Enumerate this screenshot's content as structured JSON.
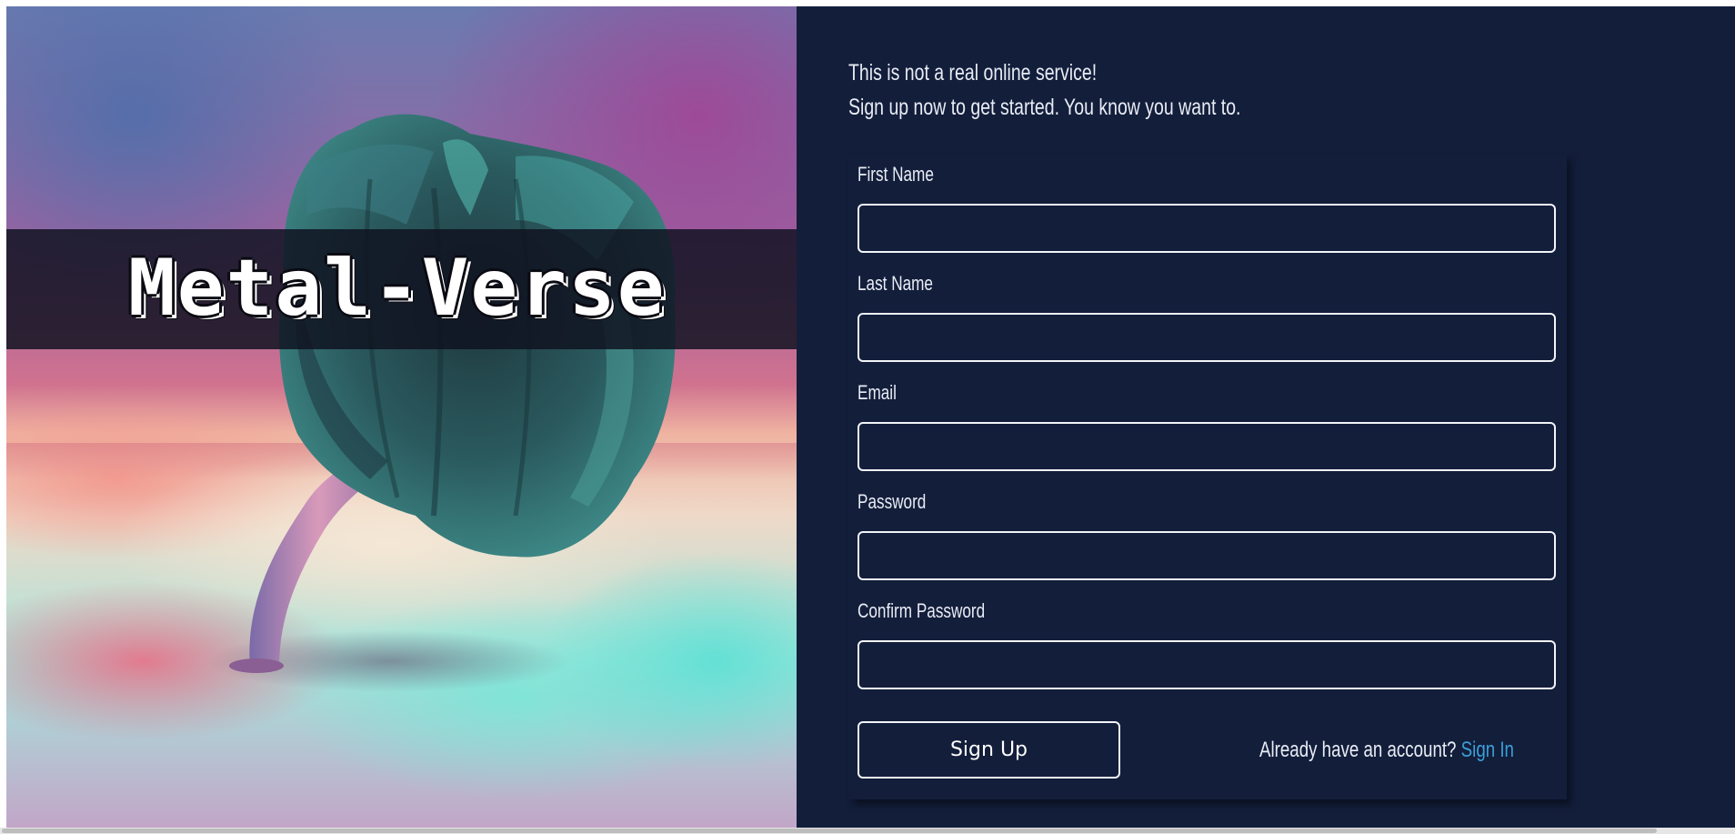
{
  "hero": {
    "brand": "Metal-Verse"
  },
  "intro": {
    "line1": "This is not a real online service!",
    "line2": "Sign up now to get started. You know you want to."
  },
  "form": {
    "fields": [
      {
        "label": "First Name",
        "value": "",
        "type": "text"
      },
      {
        "label": "Last Name",
        "value": "",
        "type": "text"
      },
      {
        "label": "Email",
        "value": "",
        "type": "email"
      },
      {
        "label": "Password",
        "value": "",
        "type": "password"
      },
      {
        "label": "Confirm Password",
        "value": "",
        "type": "password"
      }
    ],
    "submit_label": "Sign Up",
    "signin_prompt": "Already have an account?",
    "signin_link": "Sign In"
  },
  "colors": {
    "background": "#131e3b",
    "text": "#e8ecf4",
    "link": "#3aa0d8",
    "border": "#f2f4f8"
  }
}
